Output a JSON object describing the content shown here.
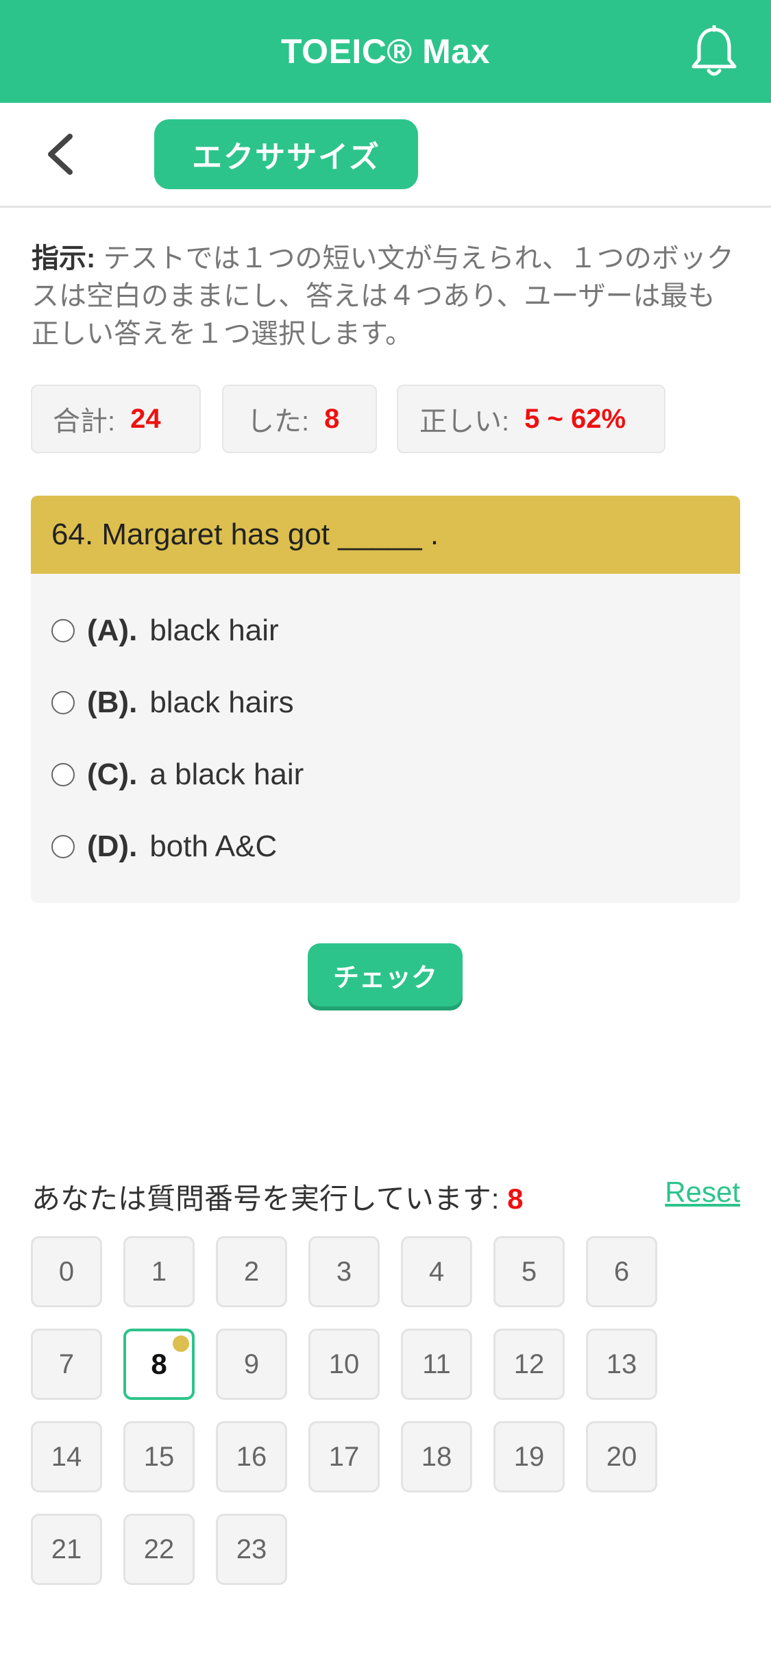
{
  "header": {
    "title": "TOEIC® Max",
    "bell_icon": "bell-icon"
  },
  "subheader": {
    "back_icon": "chevron-left-icon",
    "mode_button": "エクササイズ"
  },
  "instructions": {
    "label": "指示:",
    "text": " テストでは１つの短い文が与えられ、１つのボックスは空白のままにし、答えは４つあり、ユーザーは最も正しい答えを１つ選択します。"
  },
  "stats": {
    "total_label": "合計:",
    "total_value": "24",
    "done_label": "した:",
    "done_value": "8",
    "correct_label": "正しい:",
    "correct_value": "5 ~ 62%"
  },
  "question": {
    "text": "64. Margaret has got _____ .",
    "options": [
      {
        "letter": "(A).",
        "text": "black hair"
      },
      {
        "letter": "(B).",
        "text": "black hairs"
      },
      {
        "letter": "(C).",
        "text": "a black hair"
      },
      {
        "letter": "(D).",
        "text": "both A&C"
      }
    ]
  },
  "check_button": "チェック",
  "navigator": {
    "label": "あなたは質問番号を実行しています:",
    "current": "8",
    "reset_label": "Reset",
    "numbers": [
      "0",
      "1",
      "2",
      "3",
      "4",
      "5",
      "6",
      "7",
      "8",
      "9",
      "10",
      "11",
      "12",
      "13",
      "14",
      "15",
      "16",
      "17",
      "18",
      "19",
      "20",
      "21",
      "22",
      "23"
    ]
  },
  "colors": {
    "brand": "#2dc48b",
    "question_header": "#dcbf4e",
    "highlight": "#e11111"
  }
}
